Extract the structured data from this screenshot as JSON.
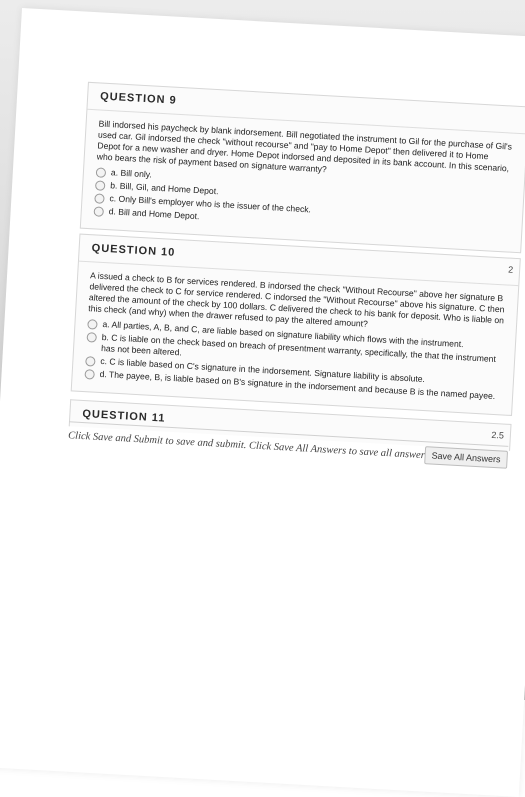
{
  "q9": {
    "title": "QUESTION 9",
    "text": "Bill indorsed his paycheck by blank indorsement. Bill negotiated the instrument to Gil for the purchase of Gil's used car. Gil indorsed the check \"without recourse\" and \"pay to Home Depot\" then delivered it to Home Depot for a new washer and dryer. Home Depot indorsed and deposited in its bank account. In this scenario, who bears the risk of payment based on signature warranty?",
    "options": [
      "a. Bill only.",
      "b. Bill, Gil, and Home Depot.",
      "c. Only Bill's employer who is the issuer of the check.",
      "d. Bill and Home Depot."
    ]
  },
  "q10": {
    "title": "QUESTION 10",
    "points": "2",
    "text": "A issued a check to B for services rendered. B indorsed the check \"Without Recourse\" above her signature B delivered the check to C for service rendered. C indorsed the \"Without Recourse\" above his signature. C then altered the amount of the check by 100 dollars. C delivered the check to his bank for deposit. Who is liable on this check (and why) when the drawer refused to pay the altered amount?",
    "options": [
      "a. All parties, A, B, and C, are liable based on signature liability which flows with the instrument.",
      "b. C is liable on the check based on breach of presentment warranty, specifically, the that the instrument has not been altered.",
      "c. C is liable based on C's signature in the indorsement. Signature liability is absolute.",
      "d. The payee, B, is liable based on B's signature in the indorsement and because B is the named payee."
    ]
  },
  "q11": {
    "title": "QUESTION 11",
    "points": "2.5"
  },
  "footer": {
    "instruction": "Click Save and Submit to save and submit. Click Save All Answers to save all answers.",
    "save_all": "Save All Answers"
  }
}
